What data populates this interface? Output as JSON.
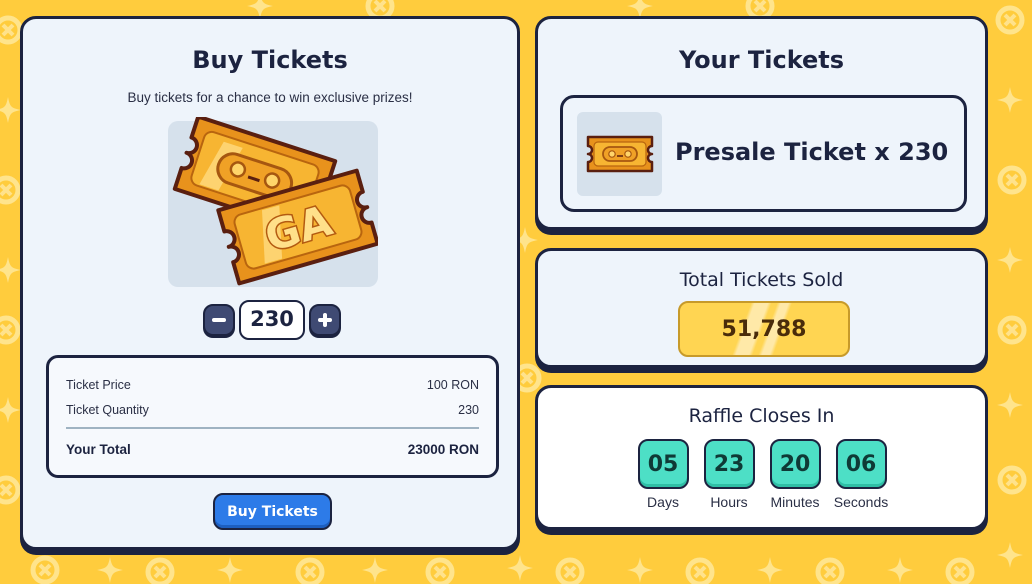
{
  "colors": {
    "background": "#ffcc3d",
    "panel": "#eef4fb",
    "outline": "#1c2340",
    "buy_button": "#2d7be8",
    "countdown": "#4ddfc6",
    "sold_badge": "#ffd552"
  },
  "buy": {
    "title": "Buy Tickets",
    "subtitle": "Buy tickets for a chance to win exclusive prizes!",
    "image_icon": "golden-tickets-icon",
    "quantity": "230",
    "minus_icon": "minus-icon",
    "plus_icon": "plus-icon",
    "summary": {
      "price_label": "Ticket Price",
      "price_value": "100 RON",
      "quantity_label": "Ticket Quantity",
      "quantity_value": "230",
      "total_label": "Your Total",
      "total_value": "23000 RON"
    },
    "button_label": "Buy Tickets"
  },
  "your_tickets": {
    "title": "Your Tickets",
    "item_name": "Presale Ticket x 230",
    "item_icon": "ticket-icon"
  },
  "sold": {
    "title": "Total Tickets Sold",
    "value": "51,788"
  },
  "raffle": {
    "title": "Raffle Closes In",
    "units": [
      {
        "value": "05",
        "label": "Days"
      },
      {
        "value": "23",
        "label": "Hours"
      },
      {
        "value": "20",
        "label": "Minutes"
      },
      {
        "value": "06",
        "label": "Seconds"
      }
    ]
  }
}
